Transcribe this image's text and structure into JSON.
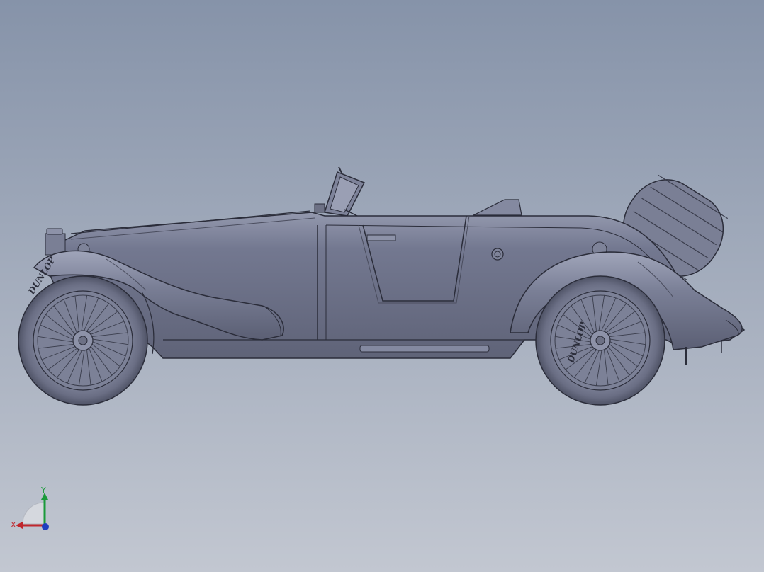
{
  "viewport": {
    "background_top": "#8693a9",
    "background_bottom": "#c2c7d1"
  },
  "model": {
    "body_color": "#6d7185",
    "highlight_color": "#8d92a8",
    "edge_color": "#2b2d3a",
    "tire_text_front": "DUNLOP",
    "tire_text_rear": "DUNLOP"
  },
  "triad": {
    "x_label": "X",
    "y_label": "Y",
    "x_color": "#c0272d",
    "y_color": "#1a9a3a",
    "z_color": "#1f3fbf"
  }
}
